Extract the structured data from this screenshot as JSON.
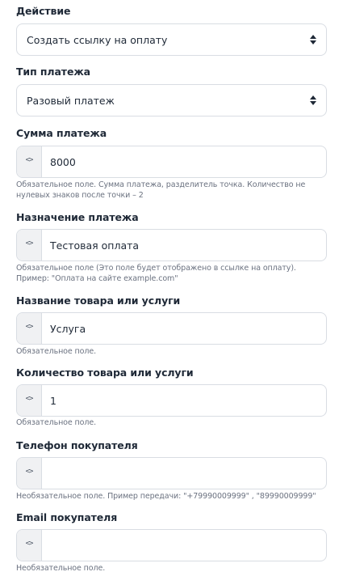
{
  "form": {
    "action": {
      "label": "Действие",
      "selected": "Создать ссылку на оплату",
      "arrows_icon": "sort-arrows-icon"
    },
    "payment_type": {
      "label": "Тип платежа",
      "selected": "Разовый платеж",
      "arrows_icon": "sort-arrows-icon"
    },
    "amount": {
      "label": "Сумма платежа",
      "addon": "<>",
      "value": "8000",
      "hint": "Обязательное поле. Сумма платежа, разделитель точка. Количество не нулевых знаков после точки – 2"
    },
    "purpose": {
      "label": "Назначение платежа",
      "addon": "<>",
      "value": "Тестовая оплата",
      "hint": "Обязательное поле (Это поле будет отображено в ссылке на оплату). Пример: \"Оплата на сайте example.com\""
    },
    "product_name": {
      "label": "Название товара или услуги",
      "addon": "<>",
      "value": "Услуга",
      "hint": "Обязательное поле."
    },
    "product_quantity": {
      "label": "Количество товара или услуги",
      "addon": "<>",
      "value": "1",
      "hint": "Обязательное поле."
    },
    "buyer_phone": {
      "label": "Телефон покупателя",
      "addon": "<>",
      "value": "",
      "hint": "Необязательное поле. Пример передачи: \"+79990009999\" , \"89990009999\""
    },
    "buyer_email": {
      "label": "Email покупателя",
      "addon": "<>",
      "value": "",
      "hint": "Необязательное поле."
    }
  },
  "colors": {
    "label": "#1f2937",
    "hint": "#6b7280",
    "border": "#d9dde3",
    "addon_bg": "#f0f1f3"
  }
}
